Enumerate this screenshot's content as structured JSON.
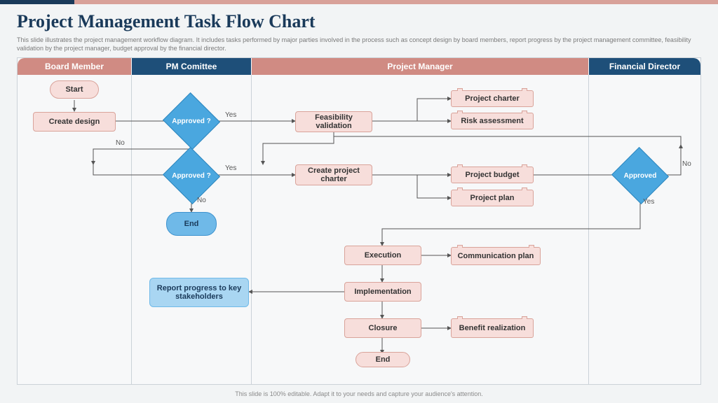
{
  "title": "Project Management Task Flow Chart",
  "subtitle": "This slide illustrates the project management workflow diagram. It includes tasks performed by major parties involved in the process such as concept design by board members, report progress by the project management committee, feasibility validation by the project manager, budget approval by the financial director.",
  "footer": "This slide is 100% editable. Adapt it to your needs and capture your audience's attention.",
  "lanes": {
    "board_member": "Board Member",
    "pm_committee": "PM Comittee",
    "project_manager": "Project Manager",
    "financial_director": "Financial Director"
  },
  "nodes": {
    "start": "Start",
    "create_design": "Create design",
    "approved1": "Approved ?",
    "approved2": "Approved ?",
    "end1": "End",
    "feasibility": "Feasibility validation",
    "create_charter": "Create project charter",
    "execution": "Execution",
    "implementation": "Implementation",
    "closure": "Closure",
    "end2": "End",
    "report_progress": "Report progress to key stakeholders",
    "project_charter": "Project charter",
    "risk_assessment": "Risk assessment",
    "project_budget": "Project budget",
    "project_plan": "Project plan",
    "comm_plan": "Communication plan",
    "benefit": "Benefit realization",
    "approved3": "Approved"
  },
  "labels": {
    "yes": "Yes",
    "no": "No"
  },
  "chart_data": {
    "type": "flowchart",
    "swimlanes": [
      "Board Member",
      "PM Comittee",
      "Project Manager",
      "Financial Director"
    ],
    "nodes": [
      {
        "id": "start",
        "lane": "Board Member",
        "type": "terminator",
        "label": "Start"
      },
      {
        "id": "create_design",
        "lane": "Board Member",
        "type": "process",
        "label": "Create design"
      },
      {
        "id": "approved1",
        "lane": "PM Comittee",
        "type": "decision",
        "label": "Approved ?"
      },
      {
        "id": "approved2",
        "lane": "PM Comittee",
        "type": "decision",
        "label": "Approved ?"
      },
      {
        "id": "end1",
        "lane": "PM Comittee",
        "type": "terminator",
        "label": "End"
      },
      {
        "id": "report_progress",
        "lane": "PM Comittee",
        "type": "process",
        "label": "Report progress to key stakeholders"
      },
      {
        "id": "feasibility",
        "lane": "Project Manager",
        "type": "process",
        "label": "Feasibility validation"
      },
      {
        "id": "project_charter",
        "lane": "Project Manager",
        "type": "document",
        "label": "Project charter"
      },
      {
        "id": "risk_assessment",
        "lane": "Project Manager",
        "type": "document",
        "label": "Risk assessment"
      },
      {
        "id": "create_charter",
        "lane": "Project Manager",
        "type": "process",
        "label": "Create project charter"
      },
      {
        "id": "project_budget",
        "lane": "Project Manager",
        "type": "document",
        "label": "Project budget"
      },
      {
        "id": "project_plan",
        "lane": "Project Manager",
        "type": "document",
        "label": "Project plan"
      },
      {
        "id": "execution",
        "lane": "Project Manager",
        "type": "process",
        "label": "Execution"
      },
      {
        "id": "comm_plan",
        "lane": "Project Manager",
        "type": "document",
        "label": "Communication plan"
      },
      {
        "id": "implementation",
        "lane": "Project Manager",
        "type": "process",
        "label": "Implementation"
      },
      {
        "id": "closure",
        "lane": "Project Manager",
        "type": "process",
        "label": "Closure"
      },
      {
        "id": "benefit",
        "lane": "Project Manager",
        "type": "document",
        "label": "Benefit realization"
      },
      {
        "id": "end2",
        "lane": "Project Manager",
        "type": "terminator",
        "label": "End"
      },
      {
        "id": "approved3",
        "lane": "Financial Director",
        "type": "decision",
        "label": "Approved"
      }
    ],
    "edges": [
      {
        "from": "start",
        "to": "create_design"
      },
      {
        "from": "create_design",
        "to": "approved1"
      },
      {
        "from": "approved1",
        "to": "feasibility",
        "label": "Yes"
      },
      {
        "from": "approved1",
        "to": "approved2",
        "label": "No"
      },
      {
        "from": "feasibility",
        "to": "project_charter"
      },
      {
        "from": "feasibility",
        "to": "risk_assessment"
      },
      {
        "from": "feasibility",
        "to": "approved2"
      },
      {
        "from": "approved2",
        "to": "create_charter",
        "label": "Yes"
      },
      {
        "from": "approved2",
        "to": "end1",
        "label": "No"
      },
      {
        "from": "create_charter",
        "to": "project_budget"
      },
      {
        "from": "create_charter",
        "to": "project_plan"
      },
      {
        "from": "project_budget",
        "to": "approved3"
      },
      {
        "from": "approved3",
        "to": "execution",
        "label": "Yes"
      },
      {
        "from": "approved3",
        "to": "create_charter",
        "label": "No"
      },
      {
        "from": "execution",
        "to": "comm_plan"
      },
      {
        "from": "execution",
        "to": "implementation"
      },
      {
        "from": "implementation",
        "to": "closure"
      },
      {
        "from": "implementation",
        "to": "report_progress"
      },
      {
        "from": "closure",
        "to": "benefit"
      },
      {
        "from": "closure",
        "to": "end2"
      }
    ]
  }
}
